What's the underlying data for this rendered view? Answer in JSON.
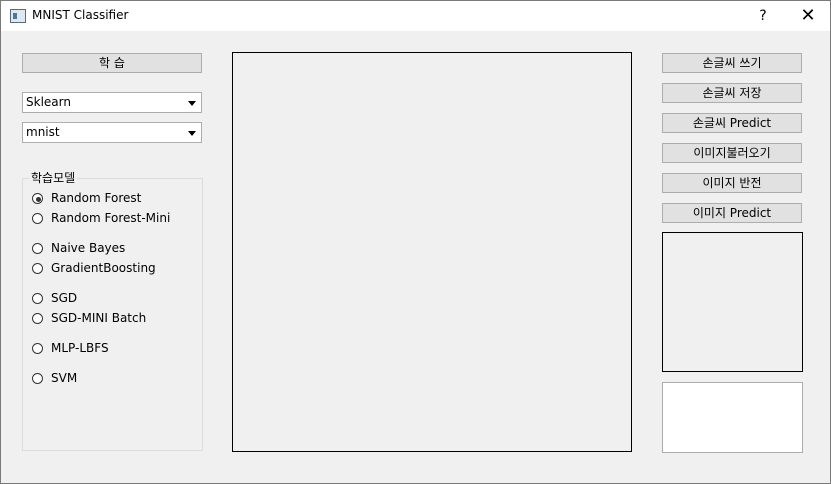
{
  "window": {
    "title": "MNIST Classifier",
    "help": "?",
    "close": "✕"
  },
  "left": {
    "train_button": "학 습",
    "framework_select": "Sklearn",
    "dataset_select": "mnist",
    "model_group_label": "학습모델",
    "models": [
      {
        "label": "Random Forest",
        "checked": true
      },
      {
        "label": "Random Forest-Mini",
        "checked": false
      },
      {
        "label": "Naive Bayes",
        "checked": false
      },
      {
        "label": "GradientBoosting",
        "checked": false
      },
      {
        "label": "SGD",
        "checked": false
      },
      {
        "label": "SGD-MINI Batch",
        "checked": false
      },
      {
        "label": "MLP-LBFS",
        "checked": false
      },
      {
        "label": "SVM",
        "checked": false
      }
    ]
  },
  "right": {
    "buttons": {
      "draw": "손글씨 쓰기",
      "save": "손글씨 저장",
      "predict_handwriting": "손글씨 Predict",
      "load_image": "이미지불러오기",
      "invert_image": "이미지 반전",
      "predict_image": "이미지 Predict"
    }
  }
}
